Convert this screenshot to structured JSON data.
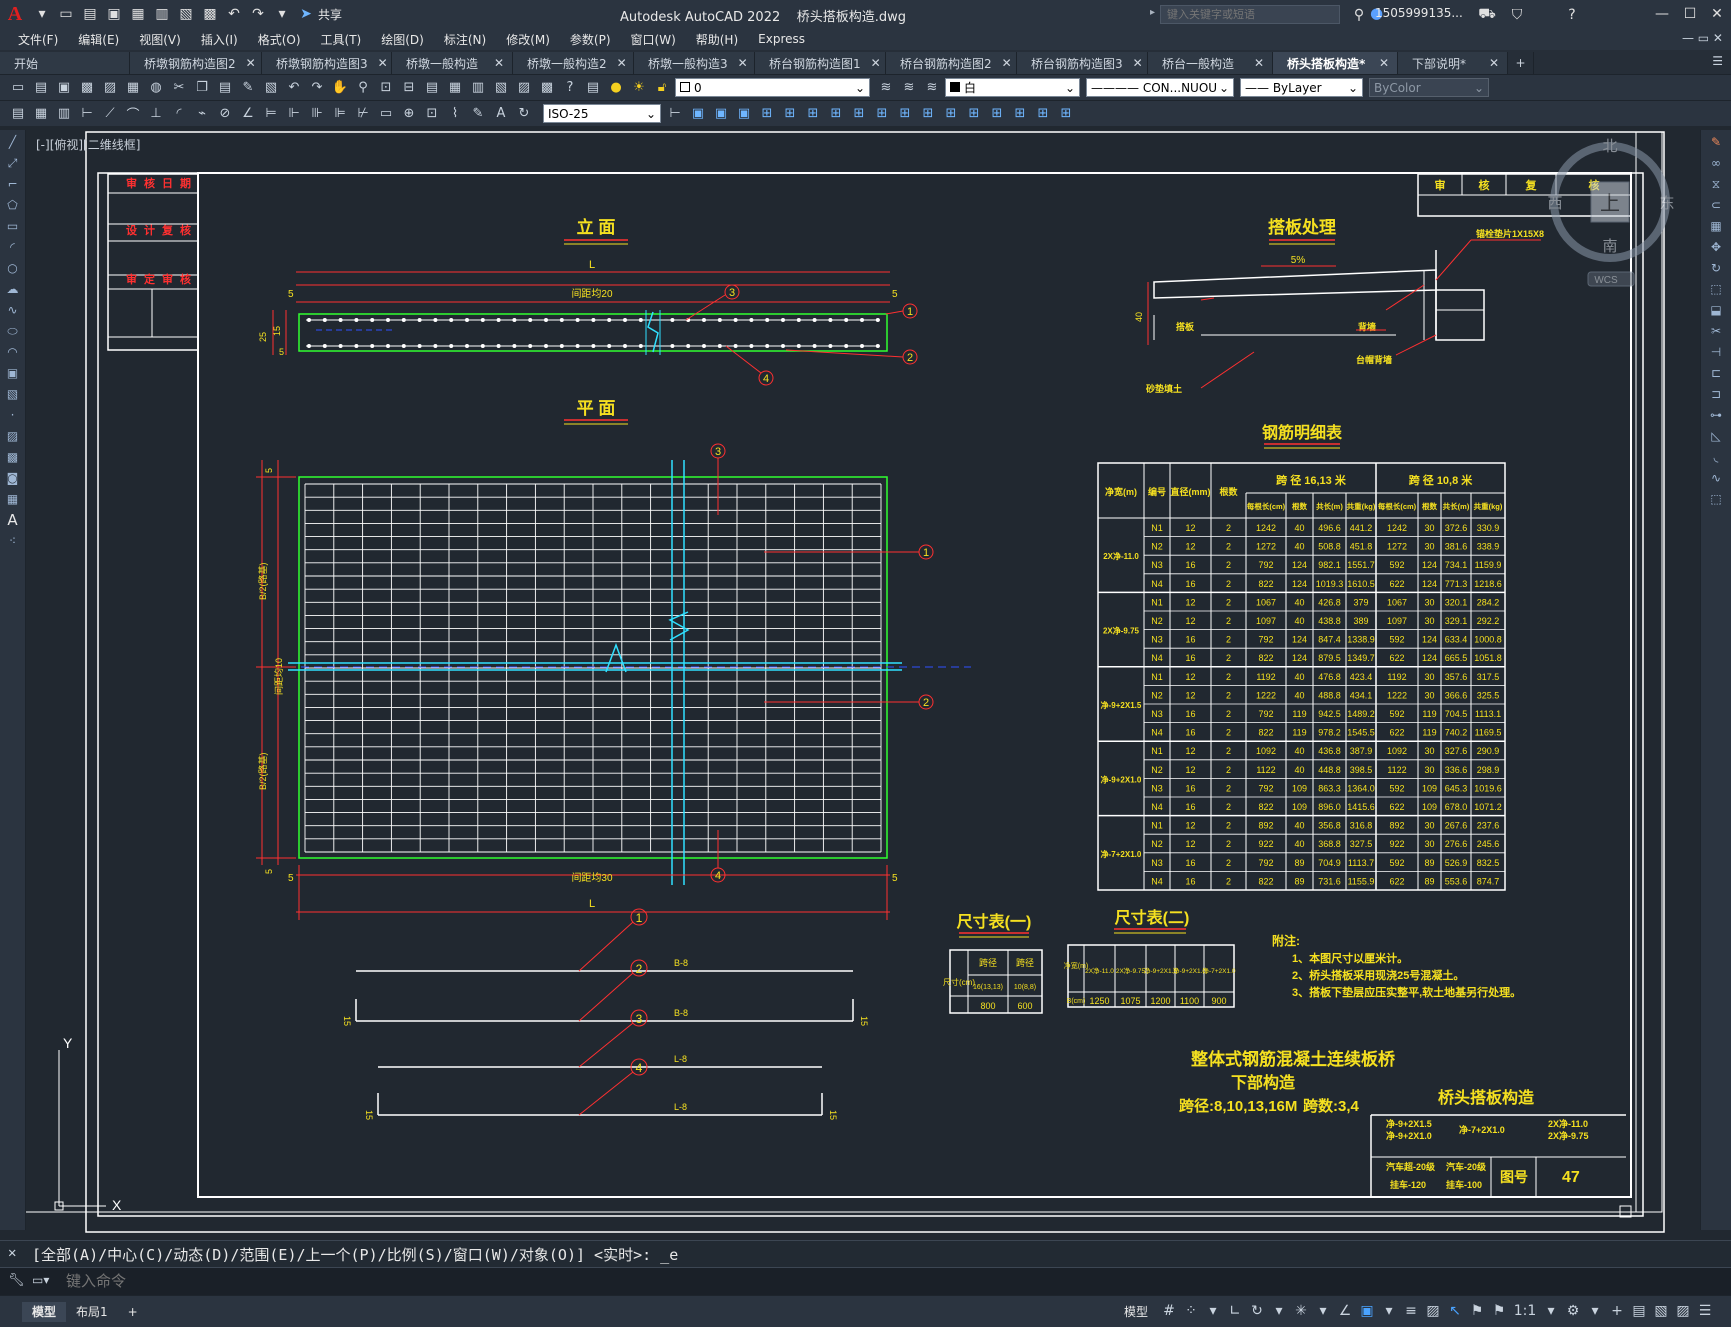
{
  "app": {
    "title": "Autodesk AutoCAD 2022    桥头搭板构造.dwg",
    "search_placeholder": "键入关键字或短语",
    "user": "1505999135...",
    "share": "共享"
  },
  "menus": [
    "文件(F)",
    "编辑(E)",
    "视图(V)",
    "插入(I)",
    "格式(O)",
    "工具(T)",
    "绘图(D)",
    "标注(N)",
    "修改(M)",
    "参数(P)",
    "窗口(W)",
    "帮助(H)",
    "Express"
  ],
  "tabs": [
    {
      "label": "开始",
      "close": false,
      "active": false
    },
    {
      "label": "桥墩钢筋构造图2",
      "close": true,
      "active": false
    },
    {
      "label": "桥墩钢筋构造图3",
      "close": true,
      "active": false
    },
    {
      "label": "桥墩一般构造",
      "close": true,
      "active": false
    },
    {
      "label": "桥墩一般构造2",
      "close": true,
      "active": false
    },
    {
      "label": "桥墩一般构造3",
      "close": true,
      "active": false
    },
    {
      "label": "桥台钢筋构造图1",
      "close": true,
      "active": false
    },
    {
      "label": "桥台钢筋构造图2",
      "close": true,
      "active": false
    },
    {
      "label": "桥台钢筋构造图3",
      "close": true,
      "active": false
    },
    {
      "label": "桥台一般构造",
      "close": true,
      "active": false
    },
    {
      "label": "桥头搭板构造*",
      "close": true,
      "active": true
    },
    {
      "label": "下部说明*",
      "close": true,
      "active": false
    }
  ],
  "toolbar": {
    "layer": "0",
    "color": "白",
    "linetype": "CON...NUOU",
    "lineweight": "ByLayer",
    "plotstyle": "ByColor",
    "dimstyle": "ISO-25"
  },
  "viewport_label": "[-][俯视][二维线框]",
  "viewcube": {
    "north": "北",
    "south": "南",
    "east": "东",
    "west": "西",
    "top": "上",
    "wcs": "WCS"
  },
  "drawing": {
    "elevation_title": "立 面",
    "plan_title": "平 面",
    "slab_title": "搭板处理",
    "rebar_table_title": "钢筋明细表",
    "dim_table1_title": "尺寸表(一)",
    "dim_table2_title": "尺寸表(二)",
    "dim_L": "L",
    "dim_5": "5",
    "elev_spacing": "间距均20",
    "plan_spacing_bottom": "间距均30",
    "plan_spacing_side": "间距均10",
    "half_B_top": "B/2(路基)",
    "half_B_bottom": "B/2(路基)",
    "dim_25": "25",
    "dim_15": "15",
    "dim_40": "40",
    "slope": "5%",
    "slab_labels": {
      "anchor": "锚栓垫片1X15X8",
      "slab": "搭板",
      "abut": "背墙",
      "pad": "台帽背墙",
      "fill": "砂垫填土"
    },
    "callouts": [
      "1",
      "2",
      "3",
      "4"
    ],
    "rebar_shapes": [
      {
        "no": "1",
        "label": "B-8"
      },
      {
        "no": "2",
        "label": "B-8"
      },
      {
        "no": "3",
        "label": "L-8"
      },
      {
        "no": "4",
        "label": "L-8"
      }
    ],
    "hook": "15",
    "title_block_top": [
      "审",
      "核",
      "复",
      "核"
    ],
    "left_block": [
      [
        "审",
        "核",
        "日",
        "期"
      ],
      [
        "设",
        "计",
        "复",
        "核"
      ],
      [
        "审",
        "定",
        "审",
        "核"
      ]
    ],
    "notes_head": "附注:",
    "notes": [
      "1、本图尺寸以厘米计。",
      "2、桥头搭板采用现浇25号混凝土。",
      "3、搭板下垫层应压实整平,软土地基另行处理。"
    ],
    "project_title": "整体式钢筋混凝土连续板桥",
    "project_sub": "下部构造",
    "span_text": "跨径:8,10,13,16M",
    "span_count": "跨数:3,4",
    "drawing_name": "桥头搭板构造",
    "tb_small": [
      "净-9+2X1.5",
      "净-7+2X1.0",
      "2X净-11.0",
      "净-9+2X1.0",
      "2X净-9.75"
    ],
    "load": [
      "汽车超-20级",
      "汽车-20级",
      "挂车-120",
      "挂车-100"
    ],
    "fig_label": "图号",
    "fig_no": "47"
  },
  "rebar_table": {
    "headers": [
      "净宽(m)",
      "编号",
      "直径(mm)",
      "根数",
      "跨 径 16,13 米",
      "跨 径 10,8 米"
    ],
    "sub_headers": [
      "每根长(cm)",
      "根数",
      "共长(m)",
      "共重(kg)",
      "每根长(cm)",
      "根数",
      "共长(m)",
      "共重(kg)"
    ],
    "groups": [
      {
        "width": "2X净-11.0",
        "rows": [
          [
            "N1",
            "12",
            "2",
            "1242",
            "40",
            "496.6",
            "441.2",
            "1242",
            "30",
            "372.6",
            "330.9"
          ],
          [
            "N2",
            "12",
            "2",
            "1272",
            "40",
            "508.8",
            "451.8",
            "1272",
            "30",
            "381.6",
            "338.9"
          ],
          [
            "N3",
            "16",
            "2",
            "792",
            "124",
            "982.1",
            "1551.7",
            "592",
            "124",
            "734.1",
            "1159.9"
          ],
          [
            "N4",
            "16",
            "2",
            "822",
            "124",
            "1019.3",
            "1610.5",
            "622",
            "124",
            "771.3",
            "1218.6"
          ]
        ]
      },
      {
        "width": "2X净-9.75",
        "rows": [
          [
            "N1",
            "12",
            "2",
            "1067",
            "40",
            "426.8",
            "379",
            "1067",
            "30",
            "320.1",
            "284.2"
          ],
          [
            "N2",
            "12",
            "2",
            "1097",
            "40",
            "438.8",
            "389",
            "1097",
            "30",
            "329.1",
            "292.2"
          ],
          [
            "N3",
            "16",
            "2",
            "792",
            "124",
            "847.4",
            "1338.9",
            "592",
            "124",
            "633.4",
            "1000.8"
          ],
          [
            "N4",
            "16",
            "2",
            "822",
            "124",
            "879.5",
            "1349.7",
            "622",
            "124",
            "665.5",
            "1051.8"
          ]
        ]
      },
      {
        "width": "净-9+2X1.5",
        "rows": [
          [
            "N1",
            "12",
            "2",
            "1192",
            "40",
            "476.8",
            "423.4",
            "1192",
            "30",
            "357.6",
            "317.5"
          ],
          [
            "N2",
            "12",
            "2",
            "1222",
            "40",
            "488.8",
            "434.1",
            "1222",
            "30",
            "366.6",
            "325.5"
          ],
          [
            "N3",
            "16",
            "2",
            "792",
            "119",
            "942.5",
            "1489.2",
            "592",
            "119",
            "704.5",
            "1113.1"
          ],
          [
            "N4",
            "16",
            "2",
            "822",
            "119",
            "978.2",
            "1545.5",
            "622",
            "119",
            "740.2",
            "1169.5"
          ]
        ]
      },
      {
        "width": "净-9+2X1.0",
        "rows": [
          [
            "N1",
            "12",
            "2",
            "1092",
            "40",
            "436.8",
            "387.9",
            "1092",
            "30",
            "327.6",
            "290.9"
          ],
          [
            "N2",
            "12",
            "2",
            "1122",
            "40",
            "448.8",
            "398.5",
            "1122",
            "30",
            "336.6",
            "298.9"
          ],
          [
            "N3",
            "16",
            "2",
            "792",
            "109",
            "863.3",
            "1364.0",
            "592",
            "109",
            "645.3",
            "1019.6"
          ],
          [
            "N4",
            "16",
            "2",
            "822",
            "109",
            "896.0",
            "1415.6",
            "622",
            "109",
            "678.0",
            "1071.2"
          ]
        ]
      },
      {
        "width": "净-7+2X1.0",
        "rows": [
          [
            "N1",
            "12",
            "2",
            "892",
            "40",
            "356.8",
            "316.8",
            "892",
            "30",
            "267.6",
            "237.6"
          ],
          [
            "N2",
            "12",
            "2",
            "922",
            "40",
            "368.8",
            "327.5",
            "922",
            "30",
            "276.6",
            "245.6"
          ],
          [
            "N3",
            "16",
            "2",
            "792",
            "89",
            "704.9",
            "1113.7",
            "592",
            "89",
            "526.9",
            "832.5"
          ],
          [
            "N4",
            "16",
            "2",
            "822",
            "89",
            "731.6",
            "1155.9",
            "622",
            "89",
            "553.6",
            "874.7"
          ]
        ]
      }
    ]
  },
  "dim_table1": {
    "row_head": "尺寸(cm)",
    "cols": [
      "跨径",
      "跨径"
    ],
    "sub": [
      "16(13,13)",
      "10(8,8)"
    ],
    "vals": [
      "800",
      "600"
    ]
  },
  "dim_table2": {
    "row_head": "B(cm)",
    "cols": [
      "2X净-11.0",
      "2X净-9.75",
      "净-9+2X1.5",
      "净-9+2X1.0",
      "净-7+2X1.0"
    ],
    "head": "净宽(m)",
    "vals": [
      "1250",
      "1075",
      "1200",
      "1100",
      "900"
    ]
  },
  "command": {
    "history": "[全部(A)/中心(C)/动态(D)/范围(E)/上一个(P)/比例(S)/窗口(W)/对象(O)] <实时>: _e",
    "placeholder": "键入命令"
  },
  "status": {
    "layouts": [
      "模型",
      "布局1"
    ],
    "model_label": "模型",
    "scale": "1:1"
  },
  "ucs": {
    "y": "Y",
    "x": "X"
  }
}
